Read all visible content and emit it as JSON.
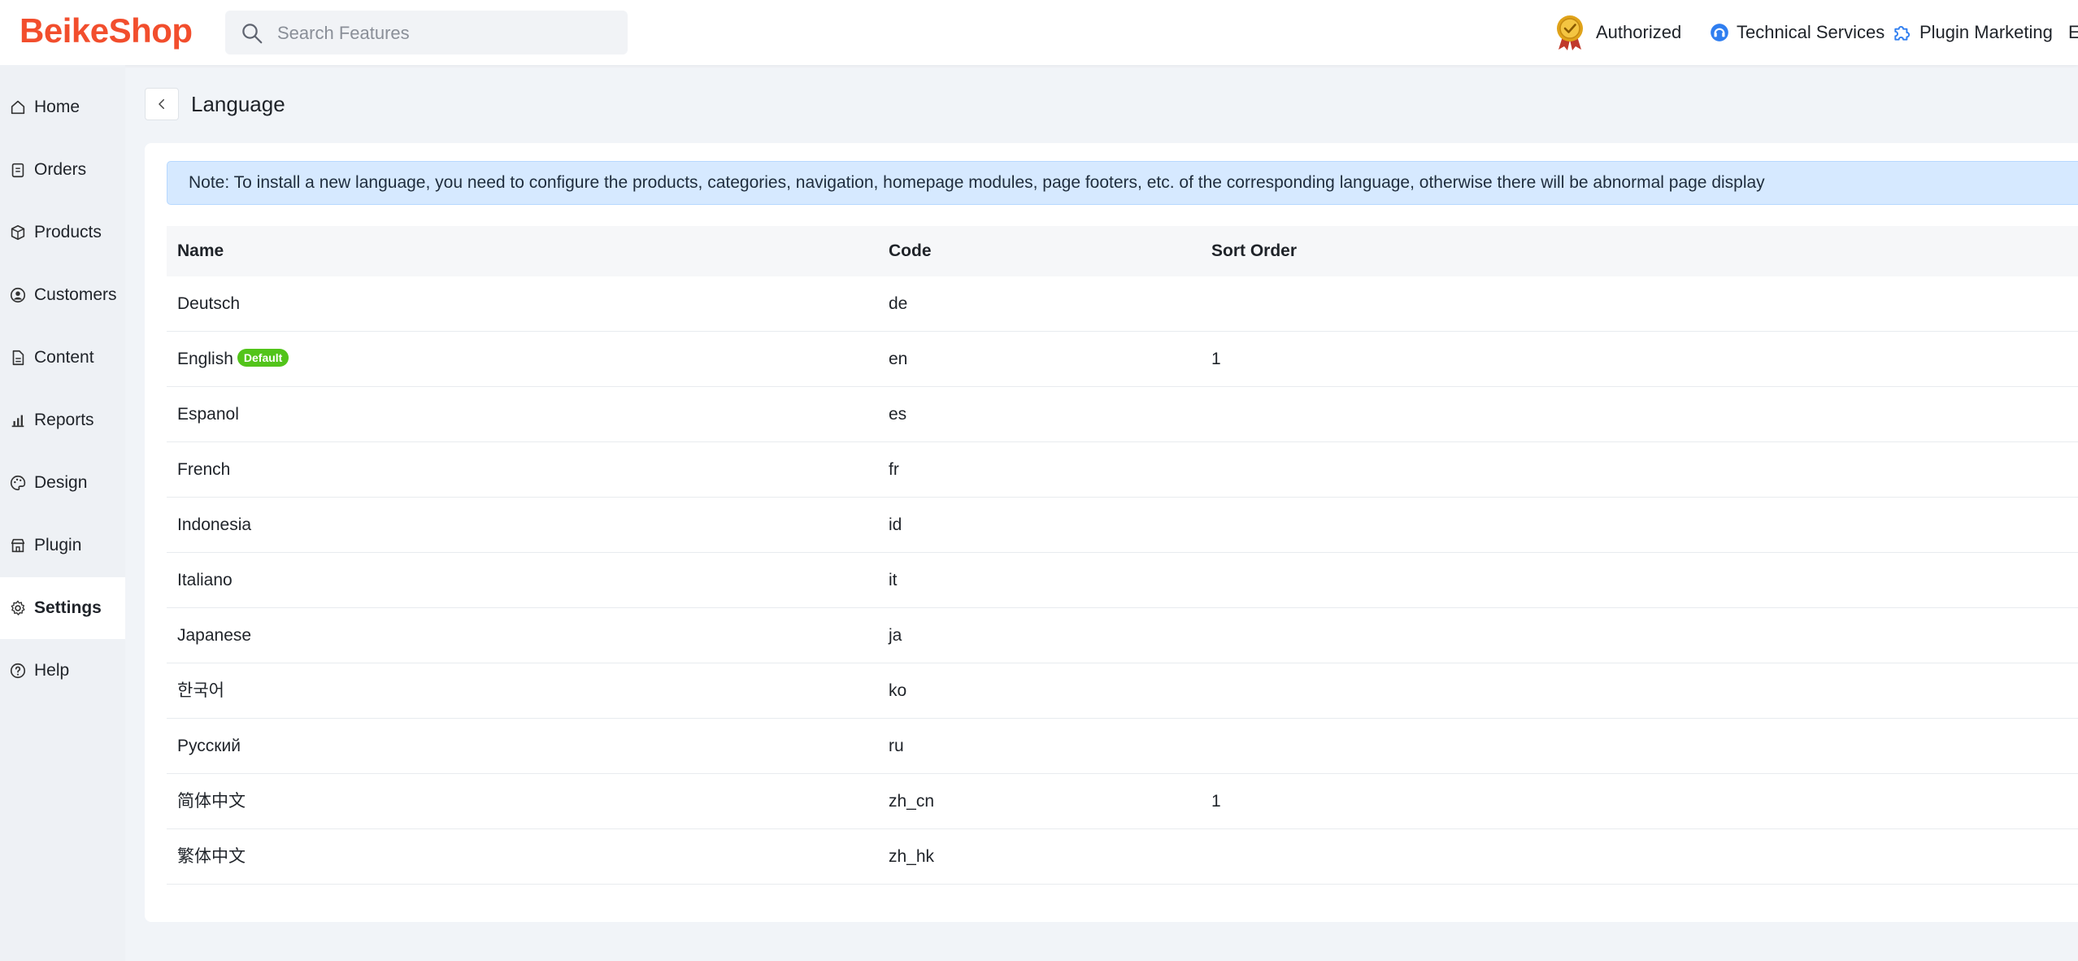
{
  "header": {
    "logo": "BeikeShop",
    "search_placeholder": "Search Features",
    "authorized": "Authorized",
    "technical_services": "Technical Services",
    "plugin_marketing": "Plugin Marketing",
    "truncated": "E"
  },
  "sidebar": {
    "items": [
      {
        "label": "Home",
        "icon": "home-icon"
      },
      {
        "label": "Orders",
        "icon": "clipboard-icon"
      },
      {
        "label": "Products",
        "icon": "box-icon"
      },
      {
        "label": "Customers",
        "icon": "user-circle-icon"
      },
      {
        "label": "Content",
        "icon": "document-icon"
      },
      {
        "label": "Reports",
        "icon": "bar-chart-icon"
      },
      {
        "label": "Design",
        "icon": "palette-icon"
      },
      {
        "label": "Plugin",
        "icon": "store-icon"
      },
      {
        "label": "Settings",
        "icon": "gear-icon"
      },
      {
        "label": "Help",
        "icon": "question-circle-icon"
      }
    ],
    "active": "Settings"
  },
  "page": {
    "title": "Language",
    "notice": "Note: To install a new language, you need to configure the products, categories, navigation, homepage modules, page footers, etc. of the corresponding language, otherwise there will be abnormal page display"
  },
  "table": {
    "headers": {
      "name": "Name",
      "code": "Code",
      "sort": "Sort Order"
    },
    "default_badge": "Default",
    "rows": [
      {
        "name": "Deutsch",
        "code": "de",
        "sort": ""
      },
      {
        "name": "English",
        "code": "en",
        "sort": "1"
      },
      {
        "name": "Espanol",
        "code": "es",
        "sort": ""
      },
      {
        "name": "French",
        "code": "fr",
        "sort": ""
      },
      {
        "name": "Indonesia",
        "code": "id",
        "sort": ""
      },
      {
        "name": "Italiano",
        "code": "it",
        "sort": ""
      },
      {
        "name": "Japanese",
        "code": "ja",
        "sort": ""
      },
      {
        "name": "한국어",
        "code": "ko",
        "sort": ""
      },
      {
        "name": "Русский",
        "code": "ru",
        "sort": ""
      },
      {
        "name": "简体中文",
        "code": "zh_cn",
        "sort": "1"
      },
      {
        "name": "繁体中文",
        "code": "zh_hk",
        "sort": ""
      }
    ]
  },
  "colors": {
    "brand": "#f24e2d",
    "badge": "#52c41a",
    "notice_bg": "#d6e9ff"
  }
}
